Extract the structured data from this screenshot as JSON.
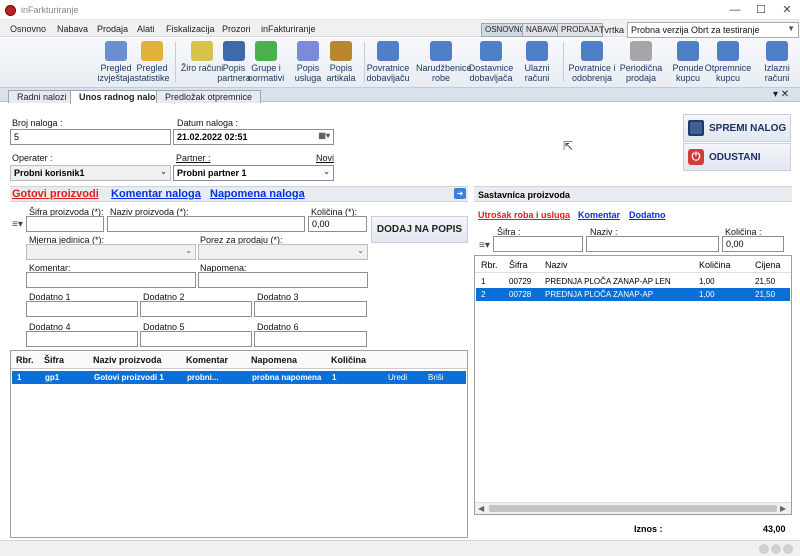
{
  "window": {
    "title": "inFarkturiranje",
    "min": "—",
    "max": "☐",
    "close": "✕"
  },
  "menu": [
    "Osnovno",
    "Nabava",
    "Prodaja",
    "Alati",
    "Fiskalizacija",
    "Prozori",
    "inFakturiranje"
  ],
  "modes": [
    "OSNOVNO",
    "NABAVA",
    "PRODAJA"
  ],
  "company": {
    "label": "Tvrtka :",
    "value": "Probna verzija Obrt za testiranje programa"
  },
  "toolbar": [
    {
      "label": "Pregled izvještaja",
      "color": "#6c8fcf"
    },
    {
      "label": "Pregled statistike",
      "color": "#e0b23a"
    },
    {
      "label": "Žiro računi",
      "color": "#d7c24a"
    },
    {
      "label": "Popis partnera",
      "color": "#3f6aa8"
    },
    {
      "label": "Grupe i normativi",
      "color": "#4caf50"
    },
    {
      "label": "Popis usluga",
      "color": "#7a8bd8"
    },
    {
      "label": "Popis artikala",
      "color": "#b8862f"
    },
    {
      "label": "Povratnice dobavljaču",
      "color": "#4f7fc6"
    },
    {
      "label": "Narudžbenice robe",
      "color": "#4f7fc6"
    },
    {
      "label": "Dostavnice dobavljača",
      "color": "#4f7fc6"
    },
    {
      "label": "Ulazni računi",
      "color": "#4f7fc6"
    },
    {
      "label": "Povratnice i odobrenja",
      "color": "#4f7fc6"
    },
    {
      "label": "Periodična prodaja",
      "color": "#a6a6a6"
    },
    {
      "label": "Ponude kupcu",
      "color": "#4f7fc6"
    },
    {
      "label": "Otpremnice kupcu",
      "color": "#4f7fc6"
    },
    {
      "label": "Izlazni računi",
      "color": "#4f7fc6"
    }
  ],
  "tabs": [
    "Radni nalozi",
    "Unos radnog naloga",
    "Predložak otpremnice"
  ],
  "tabs_controls": "▾ ✕",
  "order": {
    "number_label": "Broj naloga :",
    "number": "5",
    "date_label": "Datum naloga :",
    "date": "21.02.2022 02:51",
    "operator_label": "Operater :",
    "operator": "Probni korisnik1",
    "partner_label": "Partner :",
    "partner_new": "Novi",
    "partner": "Probni partner 1"
  },
  "actions": {
    "save": "SPREMI NALOG",
    "cancel": "ODUSTANI"
  },
  "left_tabs": {
    "products": "Gotovi proizvodi",
    "comment": "Komentar naloga",
    "note": "Napomena naloga"
  },
  "product_form": {
    "code_label": "Šifra proizvoda (*):",
    "name_label": "Naziv proizvoda (*):",
    "qty_label": "Količina (*):",
    "qty": "0,00",
    "unit_label": "Mjerna jedinica (*):",
    "tax_label": "Porez za prodaju (*):",
    "comment_label": "Komentar:",
    "note_label": "Napomena:",
    "extra": [
      "Dodatno 1",
      "Dodatno 2",
      "Dodatno 3",
      "Dodatno 4",
      "Dodatno 5",
      "Dodatno 6"
    ],
    "add_button": "DODAJ NA POPIS"
  },
  "products_table": {
    "headers": [
      "Rbr.",
      "Šifra",
      "Naziv proizvoda",
      "Komentar",
      "Napomena",
      "Količina"
    ],
    "rows": [
      {
        "rbr": "1",
        "code": "gp1",
        "name": "Gotovi proizvodi 1",
        "comment": "probni...",
        "note": "probna napomena",
        "qty": "1",
        "edit": "Uredi",
        "delete": "Briši"
      }
    ]
  },
  "composition": {
    "title": "Sastavnica proizvoda",
    "tabs": [
      "Utrošak roba i usluga",
      "Komentar",
      "Dodatno"
    ],
    "code_label": "Šifra :",
    "name_label": "Naziv :",
    "qty_label": "Količina :",
    "qty": "0,00",
    "headers": [
      "Rbr.",
      "Šifra",
      "Naziv",
      "Količina",
      "Cijena"
    ],
    "rows": [
      {
        "rbr": "1",
        "code": "00729",
        "name": "PREDNJA PLOČA ZANAP-AP LEN",
        "qty": "1,00",
        "price": "21,50"
      },
      {
        "rbr": "2",
        "code": "00728",
        "name": "PREDNJA PLOČA ZANAP-AP",
        "qty": "1,00",
        "price": "21,50"
      }
    ],
    "total_label": "Iznos :",
    "total": "43,00"
  }
}
